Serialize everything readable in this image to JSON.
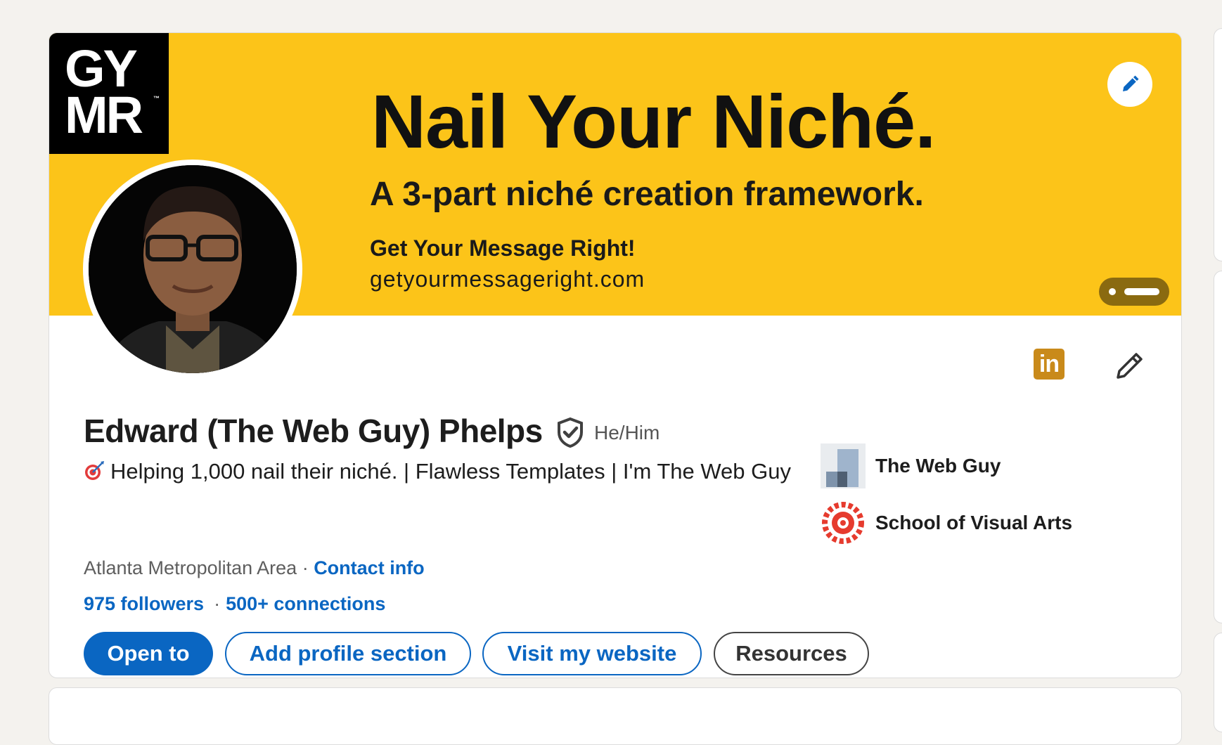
{
  "banner": {
    "logo_line1": "GY",
    "logo_line2": "MR",
    "logo_tm": "™",
    "title": "Nail Your Niché.",
    "subtitle": "A 3-part niché creation framework.",
    "line1": "Get Your Message Right!",
    "line2": "getyourmessageright.com",
    "background_color": "#fcc419"
  },
  "profile": {
    "name": "Edward (The Web Guy) Phelps",
    "pronouns": "He/Him",
    "headline_emoji": "target-emoji",
    "headline": "Helping 1,000 nail their niché. | Flawless Templates | I'm The Web Guy",
    "location": "Atlanta Metropolitan Area",
    "location_sep": " · ",
    "contact_info": "Contact info",
    "followers": "975 followers",
    "stats_sep": "·",
    "connections": "500+ connections"
  },
  "organizations": [
    {
      "name": "The Web Guy",
      "icon": "company-logo"
    },
    {
      "name": "School of Visual Arts",
      "icon": "school-logo"
    }
  ],
  "actions": {
    "open_to": "Open to",
    "add_section": "Add profile section",
    "visit_website": "Visit my website",
    "resources": "Resources"
  },
  "badges": {
    "linkedin_icon_text": "in"
  },
  "colors": {
    "accent": "#0a66c2",
    "background": "#f4f2ee"
  }
}
